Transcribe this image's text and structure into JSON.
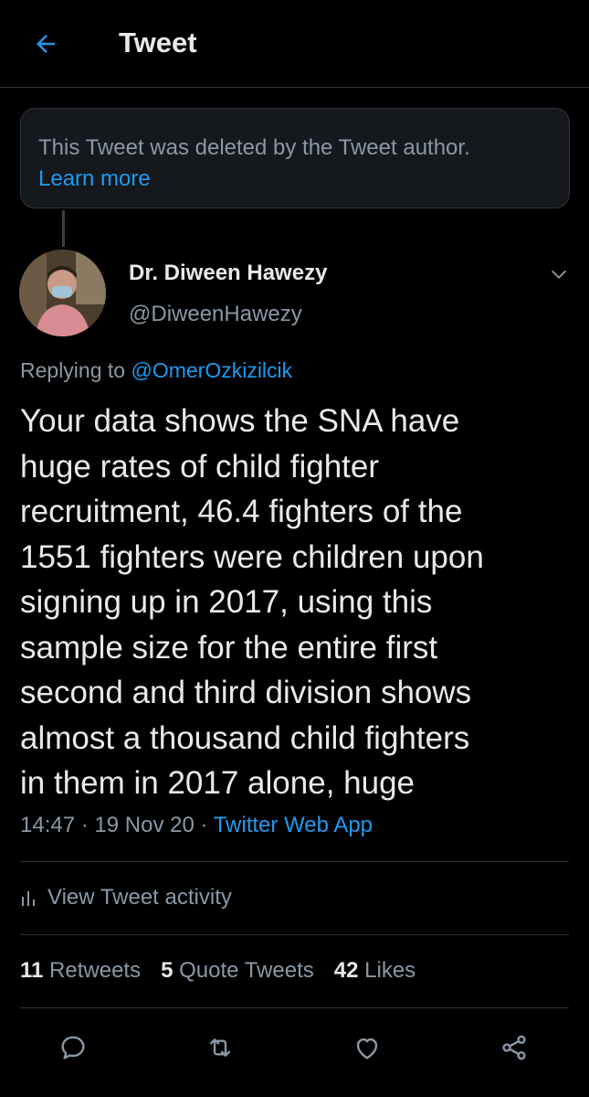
{
  "header": {
    "title": "Tweet",
    "back_icon": "arrow-left-icon"
  },
  "deleted_notice": {
    "text": "This Tweet was deleted by the Tweet author.",
    "link": "Learn more"
  },
  "author": {
    "name": "Dr. Diween Hawezy",
    "handle": "@DiweenHawezy"
  },
  "reply": {
    "prefix": "Replying to",
    "mention": "@OmerOzkizilcik"
  },
  "tweet": {
    "text": "Your data shows the SNA have\nhuge rates of child fighter\nrecruitment, 46.4 fighters of the\n1551 fighters were children upon\nsigning up in 2017, using this\nsample size for the entire first\nsecond and third division shows\nalmost a thousand child fighters\nin them in 2017 alone, huge",
    "time": "14:47",
    "date": "19 Nov 20",
    "separator": "·",
    "source": "Twitter Web App"
  },
  "activity": {
    "label": "View Tweet activity",
    "icon": "bar-chart-icon"
  },
  "stats": {
    "retweets_count": "11",
    "retweets_label": "Retweets",
    "quotes_count": "5",
    "quotes_label": "Quote Tweets",
    "likes_count": "42",
    "likes_label": "Likes"
  },
  "actions": [
    "reply-icon",
    "retweet-icon",
    "like-icon",
    "share-icon"
  ],
  "colors": {
    "accent": "#1d9bf0",
    "background": "#000000",
    "muted": "#8b98a5",
    "text": "#e7e9ea"
  }
}
